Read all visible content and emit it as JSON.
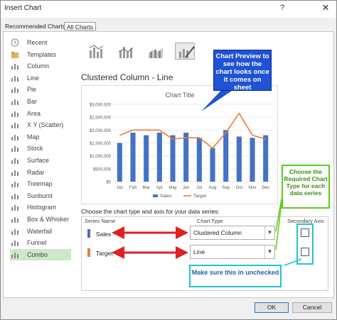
{
  "window": {
    "title": "Insert Chart",
    "help_glyph": "?",
    "close_glyph": "✕"
  },
  "tabs": {
    "recommended": "Recommended Charts",
    "all": "All Charts"
  },
  "sidebar": {
    "items": [
      {
        "label": "Recent",
        "icon": "recent-icon"
      },
      {
        "label": "Templates",
        "icon": "folder-icon"
      },
      {
        "label": "Column",
        "icon": "column-chart-icon"
      },
      {
        "label": "Line",
        "icon": "line-chart-icon"
      },
      {
        "label": "Pie",
        "icon": "pie-chart-icon"
      },
      {
        "label": "Bar",
        "icon": "bar-chart-icon"
      },
      {
        "label": "Area",
        "icon": "area-chart-icon"
      },
      {
        "label": "X Y (Scatter)",
        "icon": "scatter-chart-icon"
      },
      {
        "label": "Map",
        "icon": "map-chart-icon"
      },
      {
        "label": "Stock",
        "icon": "stock-chart-icon"
      },
      {
        "label": "Surface",
        "icon": "surface-chart-icon"
      },
      {
        "label": "Radar",
        "icon": "radar-chart-icon"
      },
      {
        "label": "Treemap",
        "icon": "treemap-chart-icon"
      },
      {
        "label": "Sunburst",
        "icon": "sunburst-chart-icon"
      },
      {
        "label": "Histogram",
        "icon": "histogram-chart-icon"
      },
      {
        "label": "Box & Whisker",
        "icon": "box-whisker-chart-icon"
      },
      {
        "label": "Waterfall",
        "icon": "waterfall-chart-icon"
      },
      {
        "label": "Funnel",
        "icon": "funnel-chart-icon"
      },
      {
        "label": "Combo",
        "icon": "combo-chart-icon"
      }
    ],
    "active": "Combo"
  },
  "subtype_title": "Clustered Column - Line",
  "chart_data": {
    "type": "bar",
    "title": "Chart Title",
    "categories": [
      "Jan",
      "Feb",
      "Mar",
      "Apr",
      "May",
      "Jun",
      "Jul",
      "Aug",
      "Sep",
      "Oct",
      "Nov",
      "Dec"
    ],
    "series": [
      {
        "name": "Sales",
        "kind": "column",
        "color": "#4472c4",
        "values": [
          1500000,
          1900000,
          1800000,
          1900000,
          1800000,
          1900000,
          1700000,
          1300000,
          2000000,
          1750000,
          1700000,
          1800000
        ]
      },
      {
        "name": "Target",
        "kind": "line",
        "color": "#ed7d31",
        "values": [
          1800000,
          2000000,
          2000000,
          2000000,
          1650000,
          1700000,
          1700000,
          1300000,
          1900000,
          2650000,
          1800000,
          1650000
        ]
      }
    ],
    "y_ticks": [
      "$0",
      "$500,000",
      "$1,000,000",
      "$1,500,000",
      "$2,000,000",
      "$2,500,000",
      "$3,000,000"
    ],
    "ylim": [
      0,
      3000000
    ],
    "grid": true,
    "legend": "bottom"
  },
  "series_config": {
    "prompt": "Choose the chart type and axis for your data series:",
    "headers": {
      "name": "Series Name",
      "type": "Chart Type",
      "axis": "Secondary Axis"
    },
    "rows": [
      {
        "name": "Sales",
        "color": "#4472c4",
        "chart_type": "Clustered Column",
        "secondary": false
      },
      {
        "name": "Target",
        "color": "#ed7d31",
        "chart_type": "Line",
        "secondary": false
      }
    ]
  },
  "callouts": {
    "preview": "Chart Preview to see how the chart looks once it comes on sheet",
    "chart_type": "Choose the Required Chart Type for each data series",
    "secondary": "Make sure this in unchecked"
  },
  "buttons": {
    "ok": "OK",
    "cancel": "Cancel"
  }
}
